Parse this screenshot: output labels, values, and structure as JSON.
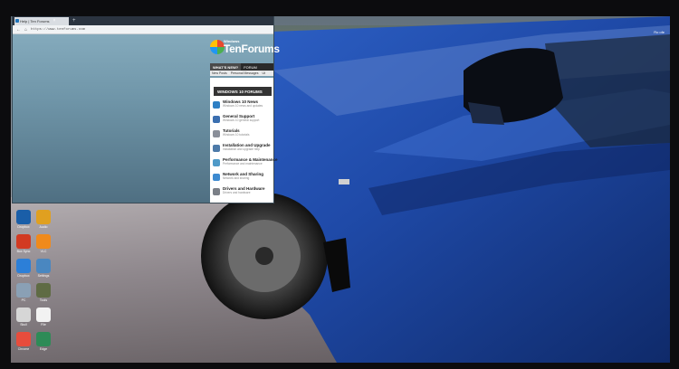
{
  "browser": {
    "tab_title": "Help | Ten Forums",
    "tab_close": "×",
    "new_tab": "+",
    "back_icon": "←",
    "home_icon": "⌂",
    "url": "https://www.tenforums.com"
  },
  "site": {
    "logo_small": "Windows",
    "logo_big": "TenForums",
    "menu": [
      {
        "label": "WHAT'S NEW?",
        "active": true
      },
      {
        "label": "FORUM",
        "active": false
      }
    ],
    "submenu": [
      "New Posts",
      "Personal Messages",
      "Ut"
    ],
    "panel_heading": "WINDOWS 10 FORUMS",
    "forums": [
      {
        "title": "Windows 10 News",
        "desc": "Windows 10 news and updates",
        "color": "#2d7fc4"
      },
      {
        "title": "General Support",
        "desc": "Windows 10 general support",
        "color": "#3b6fb0"
      },
      {
        "title": "Tutorials",
        "desc": "Windows 10 tutorials",
        "color": "#8a8f99"
      },
      {
        "title": "Installation and Upgrade",
        "desc": "Installation and upgrade help",
        "color": "#4d7aa8"
      },
      {
        "title": "Performance & Maintenance",
        "desc": "Performance and maintenance",
        "color": "#4f9ac8"
      },
      {
        "title": "Network and Sharing",
        "desc": "Network and sharing",
        "color": "#3c8ad0"
      },
      {
        "title": "Drivers and Hardware",
        "desc": "Drivers and hardware",
        "color": "#7a7f87"
      }
    ]
  },
  "desktop": {
    "icons": [
      {
        "name": "app-icon",
        "label": "Dropbox",
        "color": "#1a5ea8"
      },
      {
        "name": "app-icon",
        "label": "Audio",
        "color": "#e0a020"
      },
      {
        "name": "app-icon",
        "label": "Box Sync",
        "color": "#d23a22"
      },
      {
        "name": "app-icon",
        "label": "VLC",
        "color": "#f08a1c"
      },
      {
        "name": "app-icon",
        "label": "Dropbox",
        "color": "#2c7fd8"
      },
      {
        "name": "app-icon",
        "label": "Settings",
        "color": "#4a87c0"
      },
      {
        "name": "app-icon",
        "label": "PC",
        "color": "#8aa0b5"
      },
      {
        "name": "app-icon",
        "label": "Tools",
        "color": "#5f6b44"
      },
      {
        "name": "app-icon",
        "label": "Skull",
        "color": "#d6d6d6"
      },
      {
        "name": "app-icon",
        "label": "File",
        "color": "#f2f2f2"
      },
      {
        "name": "app-icon",
        "label": "Chrome",
        "color": "#e74c3c"
      },
      {
        "name": "app-icon",
        "label": "Edge",
        "color": "#2e8b57"
      }
    ]
  },
  "corner_text": "Ro ofe"
}
